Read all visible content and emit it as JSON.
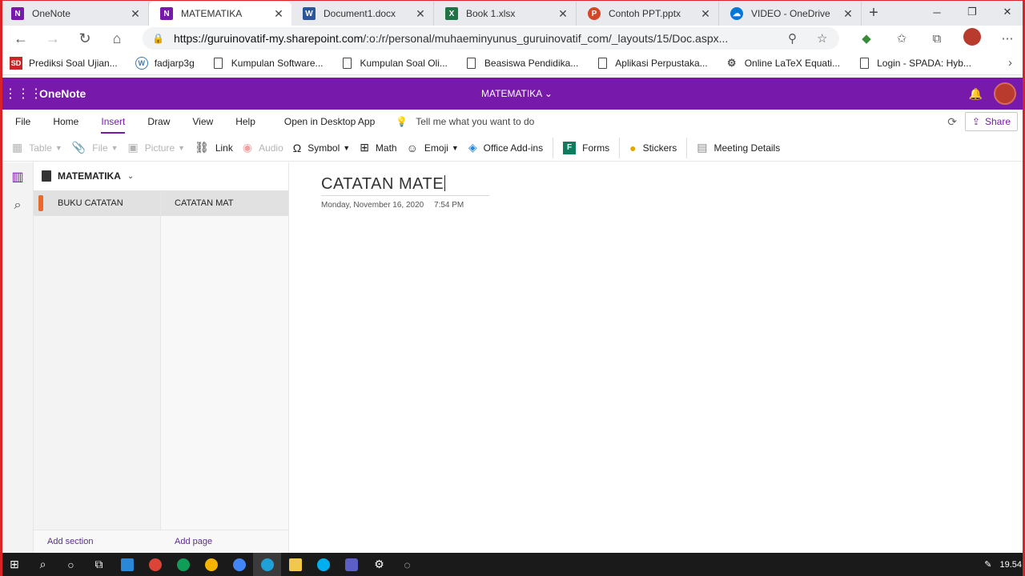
{
  "browser": {
    "tabs": [
      {
        "label": "OneNote",
        "icon": "onenote-icon",
        "color": "#7719aa",
        "glyph": "N"
      },
      {
        "label": "MATEMATIKA",
        "icon": "onenote-icon",
        "color": "#7719aa",
        "glyph": "N"
      },
      {
        "label": "Document1.docx",
        "icon": "word-icon",
        "color": "#2b579a",
        "glyph": "W"
      },
      {
        "label": "Book 1.xlsx",
        "icon": "excel-icon",
        "color": "#217346",
        "glyph": "X"
      },
      {
        "label": "Contoh PPT.pptx",
        "icon": "powerpoint-icon",
        "color": "#d24726",
        "glyph": "P"
      },
      {
        "label": "VIDEO - OneDrive",
        "icon": "onedrive-icon",
        "color": "#0078d4",
        "glyph": "☁"
      }
    ],
    "active_tab": 1,
    "url_host": "https://guruinovatif-my.sharepoint.com",
    "url_path": "/:o:/r/personal/muhaeminyunus_guruinovatif_com/_layouts/15/Doc.aspx..."
  },
  "bookmarks": [
    {
      "label": "Prediksi Soal Ujian...",
      "icon": "sd-icon"
    },
    {
      "label": "fadjarp3g",
      "icon": "wordpress-icon"
    },
    {
      "label": "Kumpulan Software...",
      "icon": "page-icon"
    },
    {
      "label": "Kumpulan Soal Oli...",
      "icon": "page-icon"
    },
    {
      "label": "Beasiswa Pendidika...",
      "icon": "page-icon"
    },
    {
      "label": "Aplikasi Perpustaka...",
      "icon": "page-icon"
    },
    {
      "label": "Online LaTeX Equati...",
      "icon": "gear-icon"
    },
    {
      "label": "Login - SPADA: Hyb...",
      "icon": "page-icon"
    }
  ],
  "onenote": {
    "app_name": "OneNote",
    "notebook_title": "MATEMATIKA ⌄",
    "menu": [
      "File",
      "Home",
      "Insert",
      "Draw",
      "View",
      "Help",
      "Open in Desktop App"
    ],
    "active_menu": "Insert",
    "tell_me": "Tell me what you want to do",
    "share_label": "Share",
    "tools": [
      {
        "label": "Table",
        "icon": "table-icon",
        "disabled": true,
        "dropdown": true
      },
      {
        "label": "File",
        "icon": "paperclip-icon",
        "disabled": true,
        "dropdown": true
      },
      {
        "label": "Picture",
        "icon": "picture-icon",
        "disabled": true,
        "dropdown": true
      },
      {
        "label": "Link",
        "icon": "link-icon",
        "disabled": false,
        "dropdown": false
      },
      {
        "label": "Audio",
        "icon": "record-icon",
        "disabled": true,
        "dropdown": false
      },
      {
        "label": "Symbol",
        "icon": "omega-icon",
        "disabled": false,
        "dropdown": true
      },
      {
        "label": "Math",
        "icon": "math-icon",
        "disabled": false,
        "dropdown": false
      },
      {
        "label": "Emoji",
        "icon": "smiley-icon",
        "disabled": false,
        "dropdown": true
      },
      {
        "label": "Office Add-ins",
        "icon": "addins-icon",
        "disabled": false,
        "dropdown": false
      },
      {
        "label": "Forms",
        "icon": "forms-icon",
        "disabled": false,
        "dropdown": false
      },
      {
        "label": "Stickers",
        "icon": "sticker-icon",
        "disabled": false,
        "dropdown": false
      },
      {
        "label": "Meeting Details",
        "icon": "meeting-icon",
        "disabled": false,
        "dropdown": false
      }
    ],
    "notebook_name": "MATEMATIKA",
    "section": "BUKU CATATAN",
    "page": "CATATAN MAT",
    "add_section": "Add section",
    "add_page": "Add page",
    "page_title": "CATATAN MATE",
    "page_date": "Monday, November 16, 2020",
    "page_time": "7:54 PM"
  },
  "taskbar": {
    "clock": "19.54"
  }
}
